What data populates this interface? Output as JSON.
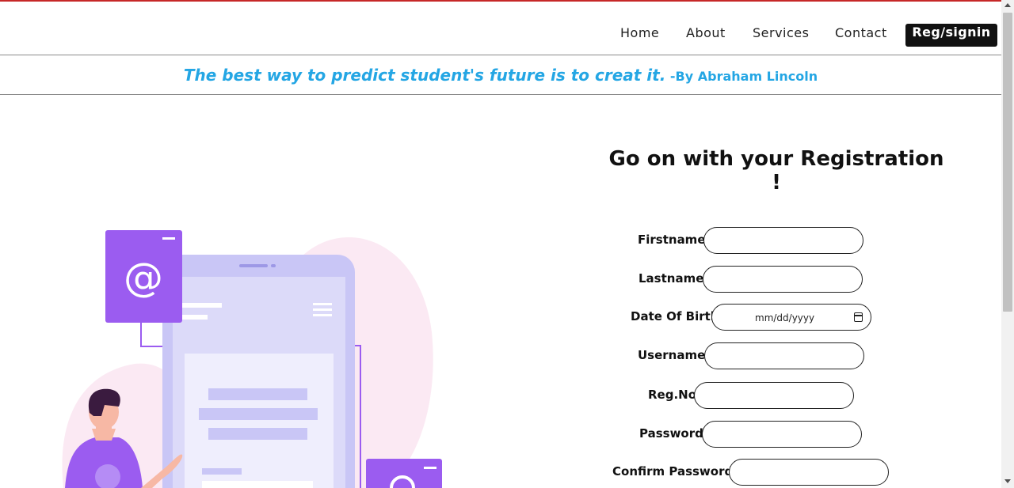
{
  "nav": {
    "items": [
      {
        "label": "Home"
      },
      {
        "label": "About"
      },
      {
        "label": "Services"
      },
      {
        "label": "Contact"
      }
    ],
    "cta_label": "Reg/signin"
  },
  "quote": {
    "text": "The best way to predict student's future is to creat it.",
    "author": "-By Abraham Lincoln"
  },
  "form": {
    "title": "Go on with your Registration !",
    "fields": [
      {
        "label": "Firstname",
        "value": ""
      },
      {
        "label": "Lastname",
        "value": ""
      },
      {
        "label": "Date Of Birth",
        "placeholder": "mm/dd/yyyy"
      },
      {
        "label": "Username",
        "value": ""
      },
      {
        "label": "Reg.No",
        "value": ""
      },
      {
        "label": "Password",
        "value": ""
      },
      {
        "label": "Confirm Password",
        "value": ""
      }
    ]
  },
  "illustration": {
    "email_symbol": "@",
    "colors": {
      "purple": "#9b5cf0",
      "phone": "#c9c6f6",
      "blob": "#fbe9f3",
      "quote_blue": "#24a6e4"
    }
  }
}
